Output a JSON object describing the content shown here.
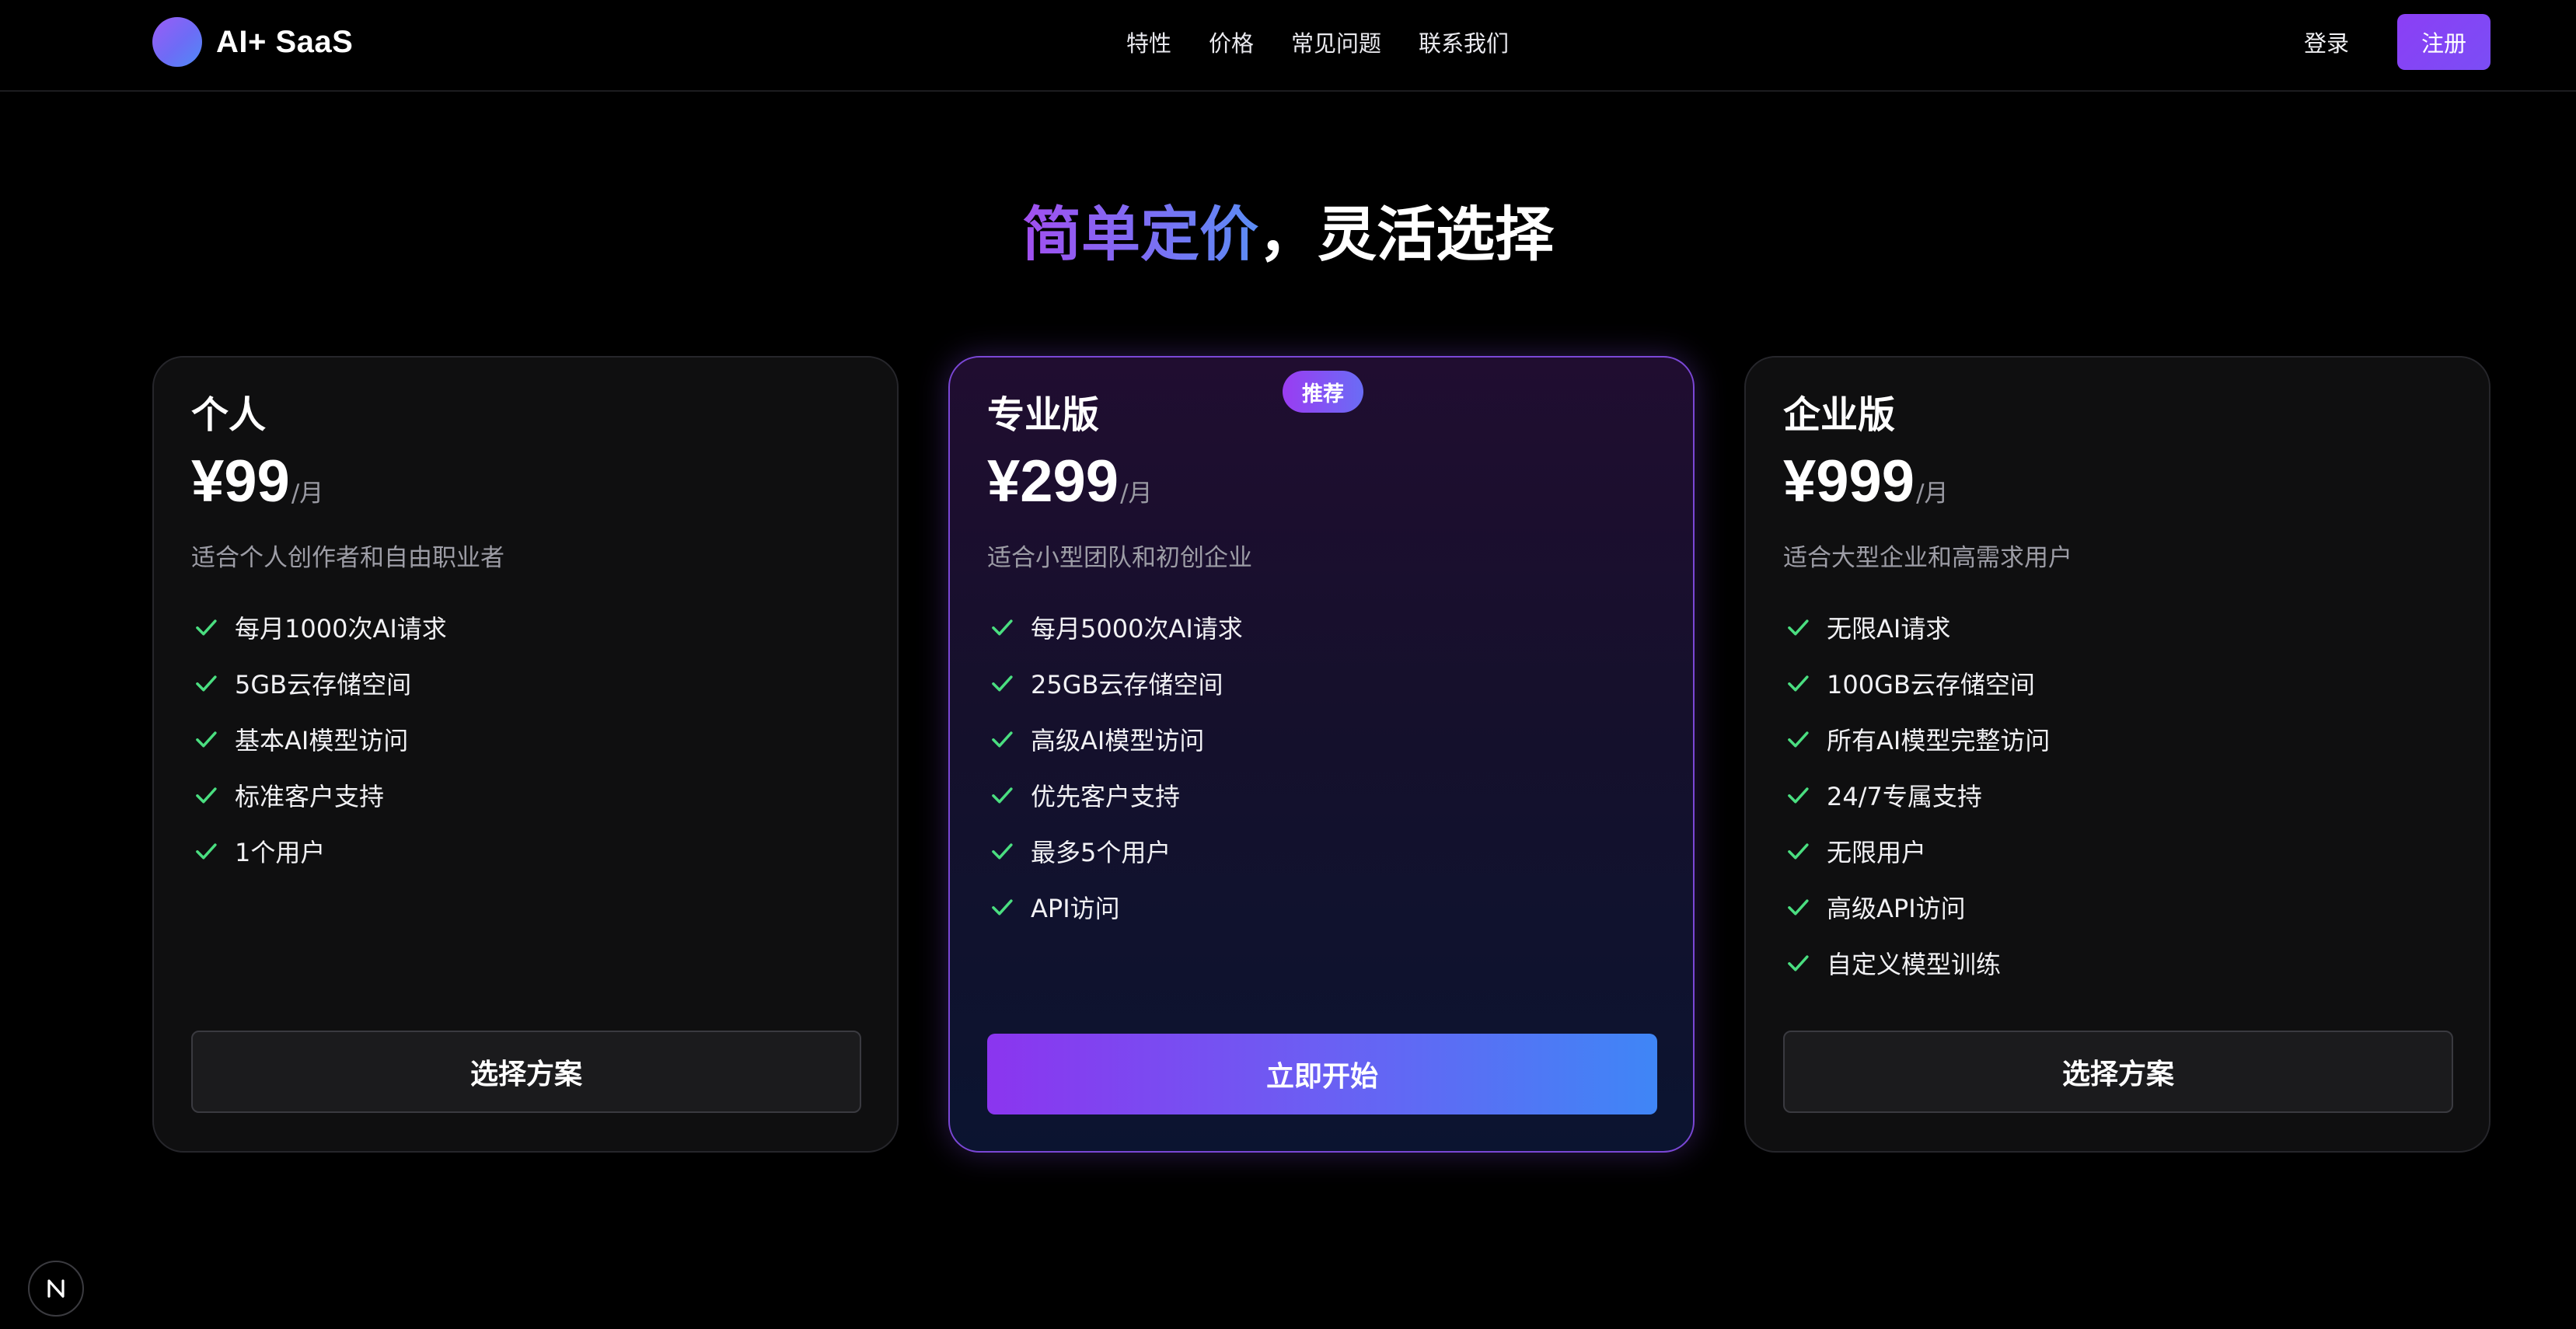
{
  "header": {
    "brand": "AI+ SaaS",
    "nav": [
      "特性",
      "价格",
      "常见问题",
      "联系我们"
    ],
    "login_label": "登录",
    "signup_label": "注册"
  },
  "heading": {
    "highlight": "简单定价",
    "rest": "，灵活选择"
  },
  "plans": [
    {
      "name": "个人",
      "price": "¥99",
      "period": "/月",
      "description": "适合个人创作者和自由职业者",
      "features": [
        "每月1000次AI请求",
        "5GB云存储空间",
        "基本AI模型访问",
        "标准客户支持",
        "1个用户"
      ],
      "cta": "选择方案"
    },
    {
      "name": "专业版",
      "badge": "推荐",
      "price": "¥299",
      "period": "/月",
      "description": "适合小型团队和初创企业",
      "features": [
        "每月5000次AI请求",
        "25GB云存储空间",
        "高级AI模型访问",
        "优先客户支持",
        "最多5个用户",
        "API访问"
      ],
      "cta": "立即开始"
    },
    {
      "name": "企业版",
      "price": "¥999",
      "period": "/月",
      "description": "适合大型企业和高需求用户",
      "features": [
        "无限AI请求",
        "100GB云存储空间",
        "所有AI模型完整访问",
        "24/7专属支持",
        "无限用户",
        "高级API访问",
        "自定义模型训练"
      ],
      "cta": "选择方案"
    }
  ],
  "colors": {
    "background": "#000000",
    "accent_purple": "#8b3ff5",
    "accent_blue": "#3f86f6",
    "check_green": "#4ade80",
    "muted_text": "#9d9da6"
  },
  "icons": {
    "logo": "gradient-circle-logo",
    "feature": "check-icon",
    "corner": "n-letter-icon"
  }
}
